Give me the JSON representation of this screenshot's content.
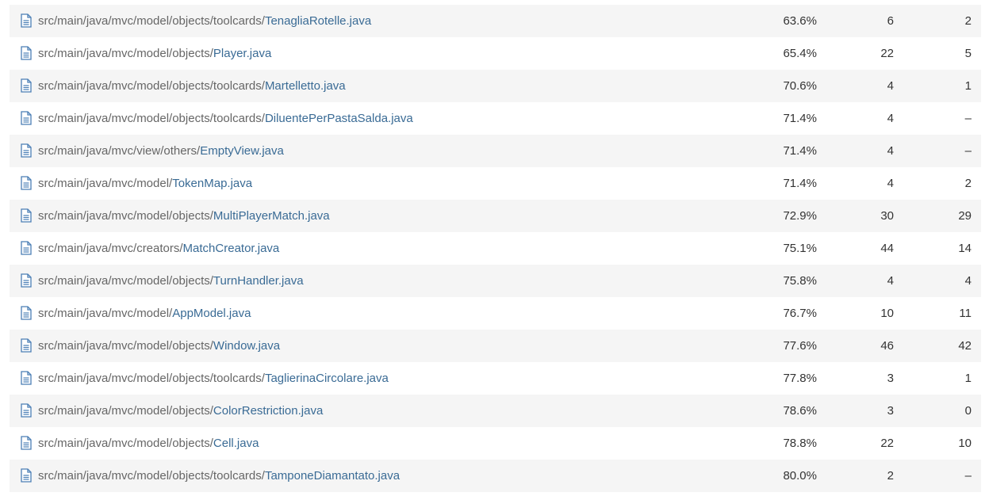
{
  "rows": [
    {
      "dir": "src/main/java/mvc/model/objects/toolcards/",
      "file": "TenagliaRotelle.java",
      "coverage": "63.6%",
      "c2": "6",
      "c3": "2"
    },
    {
      "dir": "src/main/java/mvc/model/objects/",
      "file": "Player.java",
      "coverage": "65.4%",
      "c2": "22",
      "c3": "5"
    },
    {
      "dir": "src/main/java/mvc/model/objects/toolcards/",
      "file": "Martelletto.java",
      "coverage": "70.6%",
      "c2": "4",
      "c3": "1"
    },
    {
      "dir": "src/main/java/mvc/model/objects/toolcards/",
      "file": "DiluentePerPastaSalda.java",
      "coverage": "71.4%",
      "c2": "4",
      "c3": "–"
    },
    {
      "dir": "src/main/java/mvc/view/others/",
      "file": "EmptyView.java",
      "coverage": "71.4%",
      "c2": "4",
      "c3": "–"
    },
    {
      "dir": "src/main/java/mvc/model/",
      "file": "TokenMap.java",
      "coverage": "71.4%",
      "c2": "4",
      "c3": "2"
    },
    {
      "dir": "src/main/java/mvc/model/objects/",
      "file": "MultiPlayerMatch.java",
      "coverage": "72.9%",
      "c2": "30",
      "c3": "29"
    },
    {
      "dir": "src/main/java/mvc/creators/",
      "file": "MatchCreator.java",
      "coverage": "75.1%",
      "c2": "44",
      "c3": "14"
    },
    {
      "dir": "src/main/java/mvc/model/objects/",
      "file": "TurnHandler.java",
      "coverage": "75.8%",
      "c2": "4",
      "c3": "4"
    },
    {
      "dir": "src/main/java/mvc/model/",
      "file": "AppModel.java",
      "coverage": "76.7%",
      "c2": "10",
      "c3": "11"
    },
    {
      "dir": "src/main/java/mvc/model/objects/",
      "file": "Window.java",
      "coverage": "77.6%",
      "c2": "46",
      "c3": "42"
    },
    {
      "dir": "src/main/java/mvc/model/objects/toolcards/",
      "file": "TaglierinaCircolare.java",
      "coverage": "77.8%",
      "c2": "3",
      "c3": "1"
    },
    {
      "dir": "src/main/java/mvc/model/objects/",
      "file": "ColorRestriction.java",
      "coverage": "78.6%",
      "c2": "3",
      "c3": "0"
    },
    {
      "dir": "src/main/java/mvc/model/objects/",
      "file": "Cell.java",
      "coverage": "78.8%",
      "c2": "22",
      "c3": "10"
    },
    {
      "dir": "src/main/java/mvc/model/objects/toolcards/",
      "file": "TamponeDiamantato.java",
      "coverage": "80.0%",
      "c2": "2",
      "c3": "–"
    }
  ],
  "colors": {
    "link": "#3a6b95",
    "path": "#666666",
    "text": "#333333",
    "row_alt": "#f5f5f5",
    "icon": "#4a7eb5"
  },
  "icon": "file-document-icon"
}
